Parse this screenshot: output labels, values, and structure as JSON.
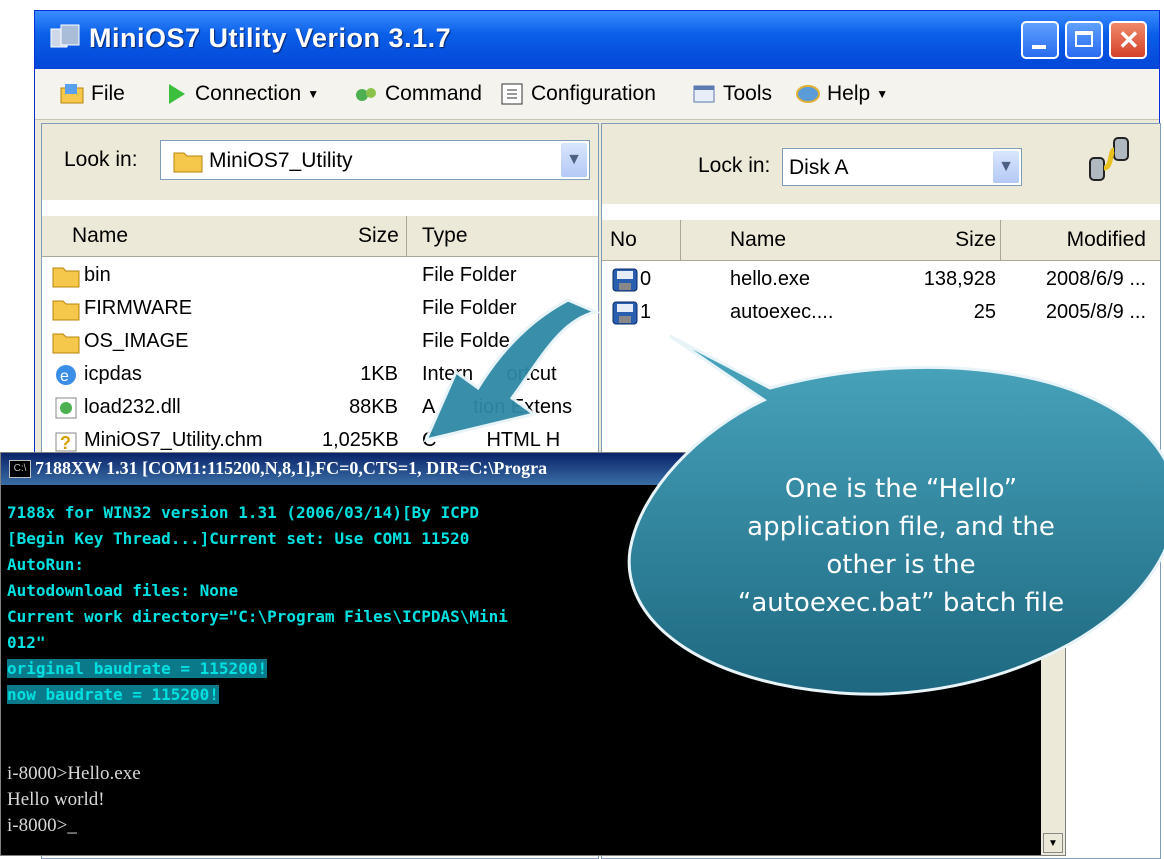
{
  "window": {
    "title": "MiniOS7 Utility Verion 3.1.7",
    "colors": {
      "titlebar": "#0a5fe8",
      "close": "#d4412a"
    }
  },
  "toolbar": {
    "items": [
      {
        "label": "File",
        "icon": "folder-file-icon"
      },
      {
        "label": "Connection",
        "icon": "play-icon",
        "dropdown": true
      },
      {
        "label": "Command",
        "icon": "command-icon"
      },
      {
        "label": "Configuration",
        "icon": "configuration-icon"
      },
      {
        "label": "Tools",
        "icon": "tools-icon"
      },
      {
        "label": "Help",
        "icon": "help-icon",
        "dropdown": true
      }
    ]
  },
  "local_pane": {
    "look_label": "Look in:",
    "look_value": "MiniOS7_Utility",
    "columns": [
      "Name",
      "Size",
      "Type"
    ],
    "rows": [
      {
        "name": "bin",
        "size": "",
        "type": "File Folder",
        "icon": "folder-icon"
      },
      {
        "name": "FIRMWARE",
        "size": "",
        "type": "File Folder",
        "icon": "folder-icon"
      },
      {
        "name": "OS_IMAGE",
        "size": "",
        "type": "File Folde",
        "icon": "folder-icon"
      },
      {
        "name": "icpdas",
        "size": "1KB",
        "type": "Intern      ortcut",
        "icon": "internet-shortcut-icon"
      },
      {
        "name": "load232.dll",
        "size": "88KB",
        "type": "A       tion Extens",
        "icon": "dll-icon"
      },
      {
        "name": "MiniOS7_Utility.chm",
        "size": "1,025KB",
        "type": "C         HTML H",
        "icon": "help-file-icon"
      }
    ]
  },
  "remote_pane": {
    "look_label": "Lock in:",
    "look_value": "Disk A",
    "columns": [
      "No",
      "Name",
      "Size",
      "Modified"
    ],
    "rows": [
      {
        "no": "0",
        "name": "hello.exe",
        "size": "138,928",
        "modified": "2008/6/9 ..."
      },
      {
        "no": "1",
        "name": "autoexec....",
        "size": "25",
        "modified": "2005/8/9 ..."
      }
    ]
  },
  "console": {
    "title": "7188XW 1.31 [COM1:115200,N,8,1],FC=0,CTS=1, DIR=C:\\Progra",
    "lines": [
      "7188x for WIN32 version 1.31 (2006/03/14)[By ICPD",
      "[Begin Key Thread...]Current set: Use COM1 11520",
      "AutoRun:",
      "Autodownload files: None",
      "Current work directory=\"C:\\Program Files\\ICPDAS\\Mini",
      "012\"",
      "original baudrate = 115200!",
      "now baudrate = 115200!",
      "i-8000>Hello.exe",
      "Hello world!",
      "i-8000>_"
    ]
  },
  "callout": {
    "text_lines": [
      "One is the “Hello”",
      "application file, and the",
      "other is the",
      "“autoexec.bat” batch file"
    ],
    "color": "#2a7d96"
  }
}
